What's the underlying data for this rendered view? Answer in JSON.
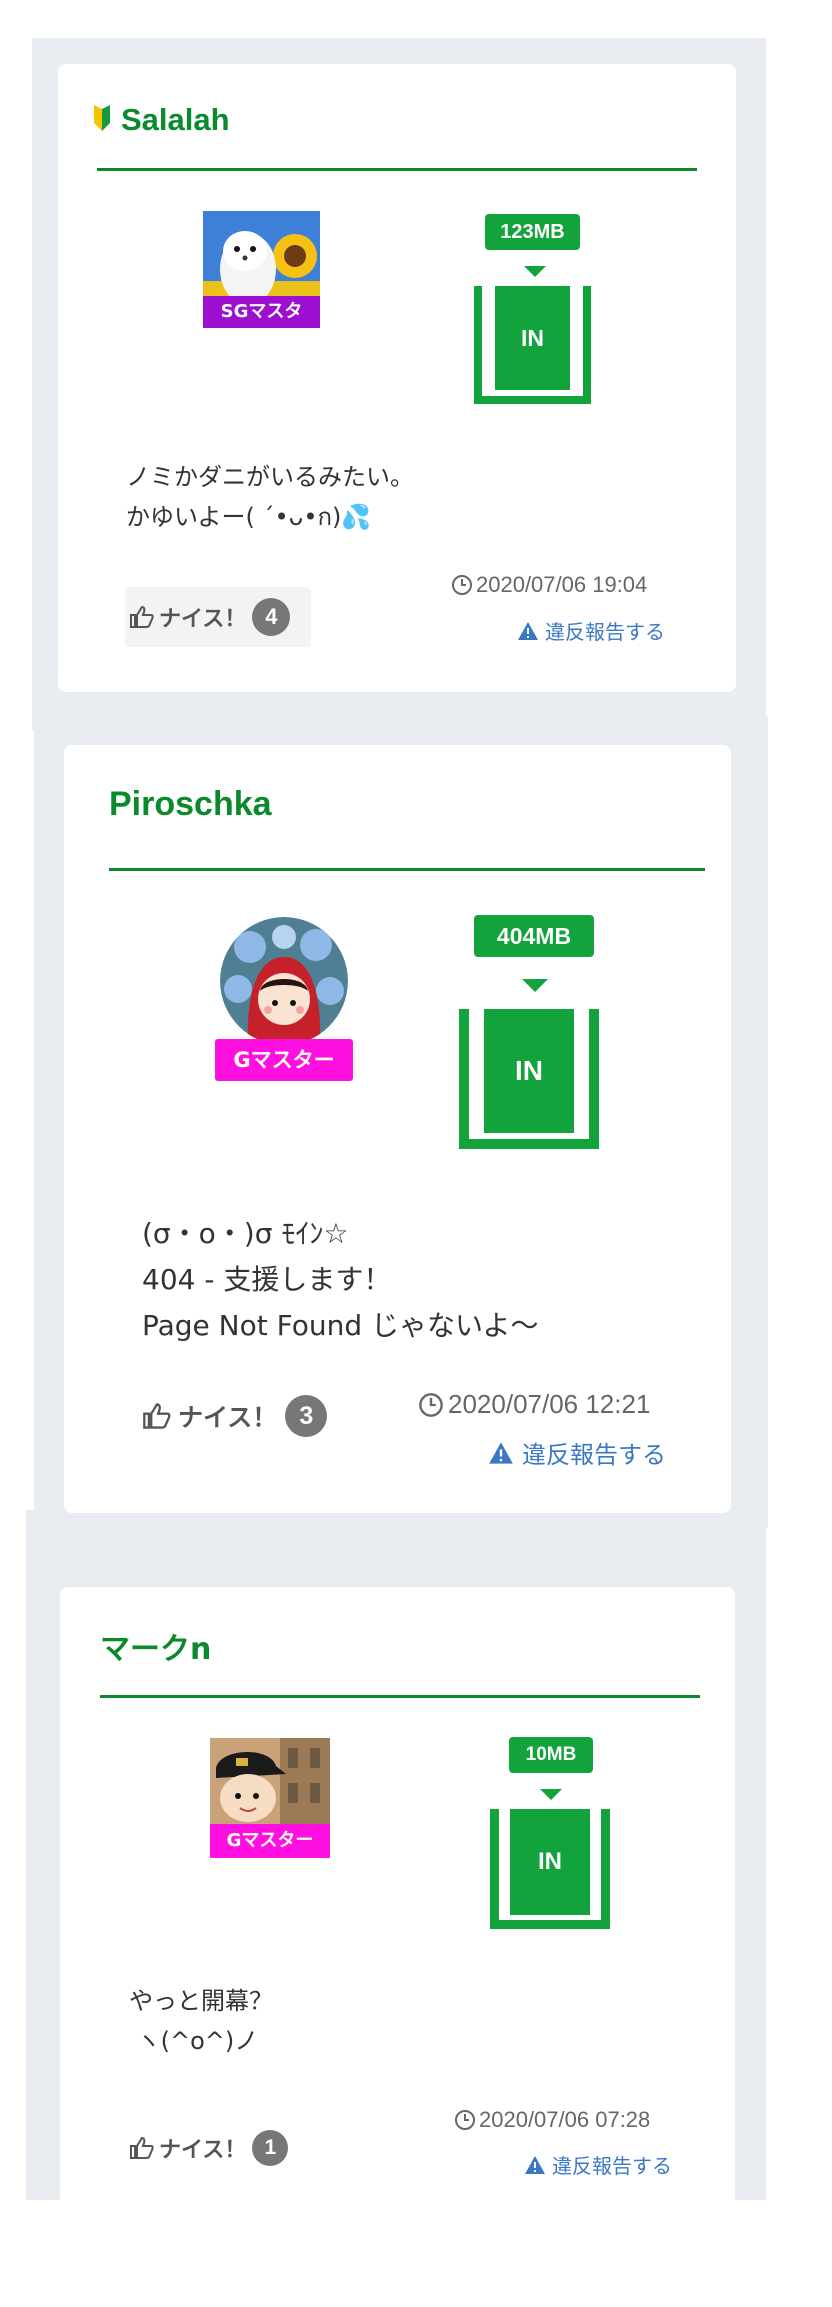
{
  "colors": {
    "accent_green": "#0b8a2b",
    "in_green": "#12a33d",
    "link_blue": "#3a78c4",
    "rank_purple": "#9d0fd0",
    "rank_magenta": "#ff10e0",
    "count_gray": "#777777"
  },
  "posts": [
    {
      "username": "Salalah",
      "beginner_badge": "beginner-mark-icon",
      "rank": "SGマスタ",
      "data_size": "123MB",
      "box_label": "IN",
      "message": "ノミかダニがいるみたい。\nかゆいよー( ´•ᴗ•ก)💦",
      "nice_label": "ナイス！",
      "nice_count": "4",
      "timestamp": "2020/07/06 19:04",
      "report_label": "違反報告する"
    },
    {
      "username": "Piroschka",
      "rank": "Gマスター",
      "data_size": "404MB",
      "box_label": "IN",
      "message": "(σ・ο・)σ ﾓｲﾝ☆\n404 - 支援します！\nPage Not Found じゃないよ〜",
      "nice_label": "ナイス！",
      "nice_count": "3",
      "timestamp": "2020/07/06 12:21",
      "report_label": "違反報告する"
    },
    {
      "username": "マークn",
      "rank": "Gマスター",
      "data_size": "10MB",
      "box_label": "IN",
      "message": "やっと開幕？\n ヽ(^o^)ノ",
      "nice_label": "ナイス！",
      "nice_count": "1",
      "timestamp": "2020/07/06 07:28",
      "report_label": "違反報告する"
    }
  ]
}
